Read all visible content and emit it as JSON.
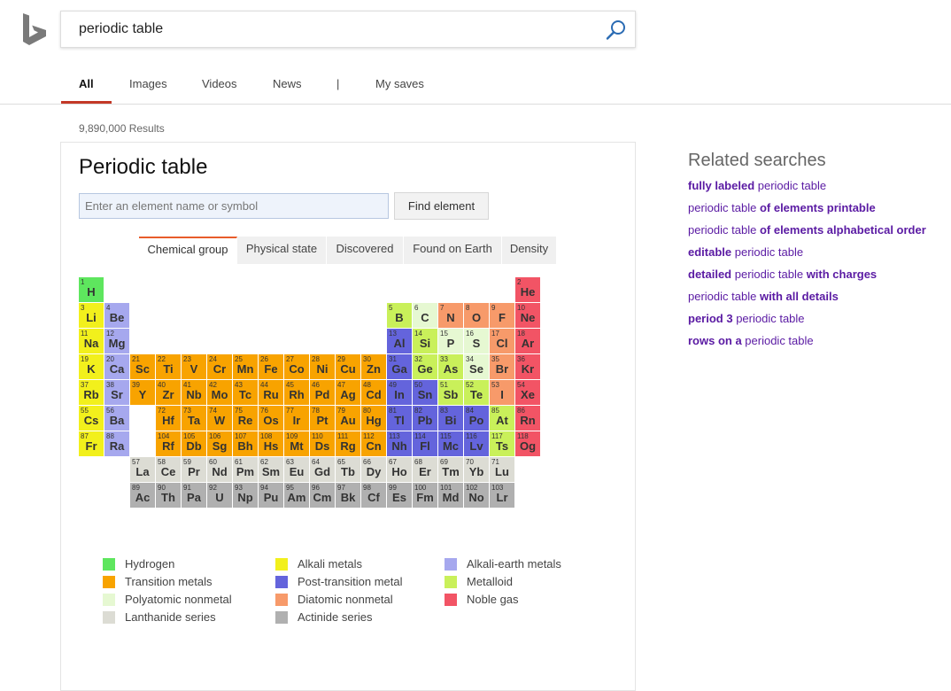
{
  "search": {
    "query": "periodic table"
  },
  "nav": {
    "tabs": [
      "All",
      "Images",
      "Videos",
      "News",
      "|",
      "My saves"
    ],
    "active": "All"
  },
  "results_count": "9,890,000 Results",
  "card": {
    "title": "Periodic table",
    "input_placeholder": "Enter an element name or symbol",
    "find_button": "Find element",
    "tabs": [
      "Chemical group",
      "Physical state",
      "Discovered",
      "Found on Earth",
      "Density"
    ],
    "active_tab": "Chemical group"
  },
  "colors": {
    "hydrogen": "#5ee65e",
    "alkali": "#f2f01c",
    "alkaline_earth": "#a6a8ee",
    "transition": "#f8a300",
    "post_transition": "#6464dc",
    "metalloid": "#c9f05a",
    "polyatomic": "#e6f8d2",
    "diatomic": "#f79a6a",
    "noble": "#f25465",
    "lanthanide": "#dcdcd4",
    "actinide": "#b0b0b0",
    "accent": "#c33827",
    "link": "#5a1aa3"
  },
  "elements": [
    {
      "n": "1",
      "s": "H",
      "p": 1,
      "g": 1,
      "c": "hydrogen"
    },
    {
      "n": "2",
      "s": "He",
      "p": 1,
      "g": 18,
      "c": "noble"
    },
    {
      "n": "3",
      "s": "Li",
      "p": 2,
      "g": 1,
      "c": "alkali"
    },
    {
      "n": "4",
      "s": "Be",
      "p": 2,
      "g": 2,
      "c": "alkaline_earth"
    },
    {
      "n": "5",
      "s": "B",
      "p": 2,
      "g": 13,
      "c": "metalloid"
    },
    {
      "n": "6",
      "s": "C",
      "p": 2,
      "g": 14,
      "c": "polyatomic"
    },
    {
      "n": "7",
      "s": "N",
      "p": 2,
      "g": 15,
      "c": "diatomic"
    },
    {
      "n": "8",
      "s": "O",
      "p": 2,
      "g": 16,
      "c": "diatomic"
    },
    {
      "n": "9",
      "s": "F",
      "p": 2,
      "g": 17,
      "c": "diatomic"
    },
    {
      "n": "10",
      "s": "Ne",
      "p": 2,
      "g": 18,
      "c": "noble"
    },
    {
      "n": "11",
      "s": "Na",
      "p": 3,
      "g": 1,
      "c": "alkali"
    },
    {
      "n": "12",
      "s": "Mg",
      "p": 3,
      "g": 2,
      "c": "alkaline_earth"
    },
    {
      "n": "13",
      "s": "Al",
      "p": 3,
      "g": 13,
      "c": "post_transition"
    },
    {
      "n": "14",
      "s": "Si",
      "p": 3,
      "g": 14,
      "c": "metalloid"
    },
    {
      "n": "15",
      "s": "P",
      "p": 3,
      "g": 15,
      "c": "polyatomic"
    },
    {
      "n": "16",
      "s": "S",
      "p": 3,
      "g": 16,
      "c": "polyatomic"
    },
    {
      "n": "17",
      "s": "Cl",
      "p": 3,
      "g": 17,
      "c": "diatomic"
    },
    {
      "n": "18",
      "s": "Ar",
      "p": 3,
      "g": 18,
      "c": "noble"
    },
    {
      "n": "19",
      "s": "K",
      "p": 4,
      "g": 1,
      "c": "alkali"
    },
    {
      "n": "20",
      "s": "Ca",
      "p": 4,
      "g": 2,
      "c": "alkaline_earth"
    },
    {
      "n": "21",
      "s": "Sc",
      "p": 4,
      "g": 3,
      "c": "transition"
    },
    {
      "n": "22",
      "s": "Ti",
      "p": 4,
      "g": 4,
      "c": "transition"
    },
    {
      "n": "23",
      "s": "V",
      "p": 4,
      "g": 5,
      "c": "transition"
    },
    {
      "n": "24",
      "s": "Cr",
      "p": 4,
      "g": 6,
      "c": "transition"
    },
    {
      "n": "25",
      "s": "Mn",
      "p": 4,
      "g": 7,
      "c": "transition"
    },
    {
      "n": "26",
      "s": "Fe",
      "p": 4,
      "g": 8,
      "c": "transition"
    },
    {
      "n": "27",
      "s": "Co",
      "p": 4,
      "g": 9,
      "c": "transition"
    },
    {
      "n": "28",
      "s": "Ni",
      "p": 4,
      "g": 10,
      "c": "transition"
    },
    {
      "n": "29",
      "s": "Cu",
      "p": 4,
      "g": 11,
      "c": "transition"
    },
    {
      "n": "30",
      "s": "Zn",
      "p": 4,
      "g": 12,
      "c": "transition"
    },
    {
      "n": "31",
      "s": "Ga",
      "p": 4,
      "g": 13,
      "c": "post_transition"
    },
    {
      "n": "32",
      "s": "Ge",
      "p": 4,
      "g": 14,
      "c": "metalloid"
    },
    {
      "n": "33",
      "s": "As",
      "p": 4,
      "g": 15,
      "c": "metalloid"
    },
    {
      "n": "34",
      "s": "Se",
      "p": 4,
      "g": 16,
      "c": "polyatomic"
    },
    {
      "n": "35",
      "s": "Br",
      "p": 4,
      "g": 17,
      "c": "diatomic"
    },
    {
      "n": "36",
      "s": "Kr",
      "p": 4,
      "g": 18,
      "c": "noble"
    },
    {
      "n": "37",
      "s": "Rb",
      "p": 5,
      "g": 1,
      "c": "alkali"
    },
    {
      "n": "38",
      "s": "Sr",
      "p": 5,
      "g": 2,
      "c": "alkaline_earth"
    },
    {
      "n": "39",
      "s": "Y",
      "p": 5,
      "g": 3,
      "c": "transition"
    },
    {
      "n": "40",
      "s": "Zr",
      "p": 5,
      "g": 4,
      "c": "transition"
    },
    {
      "n": "41",
      "s": "Nb",
      "p": 5,
      "g": 5,
      "c": "transition"
    },
    {
      "n": "42",
      "s": "Mo",
      "p": 5,
      "g": 6,
      "c": "transition"
    },
    {
      "n": "43",
      "s": "Tc",
      "p": 5,
      "g": 7,
      "c": "transition"
    },
    {
      "n": "44",
      "s": "Ru",
      "p": 5,
      "g": 8,
      "c": "transition"
    },
    {
      "n": "45",
      "s": "Rh",
      "p": 5,
      "g": 9,
      "c": "transition"
    },
    {
      "n": "46",
      "s": "Pd",
      "p": 5,
      "g": 10,
      "c": "transition"
    },
    {
      "n": "47",
      "s": "Ag",
      "p": 5,
      "g": 11,
      "c": "transition"
    },
    {
      "n": "48",
      "s": "Cd",
      "p": 5,
      "g": 12,
      "c": "transition"
    },
    {
      "n": "49",
      "s": "In",
      "p": 5,
      "g": 13,
      "c": "post_transition"
    },
    {
      "n": "50",
      "s": "Sn",
      "p": 5,
      "g": 14,
      "c": "post_transition"
    },
    {
      "n": "51",
      "s": "Sb",
      "p": 5,
      "g": 15,
      "c": "metalloid"
    },
    {
      "n": "52",
      "s": "Te",
      "p": 5,
      "g": 16,
      "c": "metalloid"
    },
    {
      "n": "53",
      "s": "I",
      "p": 5,
      "g": 17,
      "c": "diatomic"
    },
    {
      "n": "54",
      "s": "Xe",
      "p": 5,
      "g": 18,
      "c": "noble"
    },
    {
      "n": "55",
      "s": "Cs",
      "p": 6,
      "g": 1,
      "c": "alkali"
    },
    {
      "n": "56",
      "s": "Ba",
      "p": 6,
      "g": 2,
      "c": "alkaline_earth"
    },
    {
      "n": "72",
      "s": "Hf",
      "p": 6,
      "g": 4,
      "c": "transition"
    },
    {
      "n": "73",
      "s": "Ta",
      "p": 6,
      "g": 5,
      "c": "transition"
    },
    {
      "n": "74",
      "s": "W",
      "p": 6,
      "g": 6,
      "c": "transition"
    },
    {
      "n": "75",
      "s": "Re",
      "p": 6,
      "g": 7,
      "c": "transition"
    },
    {
      "n": "76",
      "s": "Os",
      "p": 6,
      "g": 8,
      "c": "transition"
    },
    {
      "n": "77",
      "s": "Ir",
      "p": 6,
      "g": 9,
      "c": "transition"
    },
    {
      "n": "78",
      "s": "Pt",
      "p": 6,
      "g": 10,
      "c": "transition"
    },
    {
      "n": "79",
      "s": "Au",
      "p": 6,
      "g": 11,
      "c": "transition"
    },
    {
      "n": "80",
      "s": "Hg",
      "p": 6,
      "g": 12,
      "c": "transition"
    },
    {
      "n": "81",
      "s": "Tl",
      "p": 6,
      "g": 13,
      "c": "post_transition"
    },
    {
      "n": "82",
      "s": "Pb",
      "p": 6,
      "g": 14,
      "c": "post_transition"
    },
    {
      "n": "83",
      "s": "Bi",
      "p": 6,
      "g": 15,
      "c": "post_transition"
    },
    {
      "n": "84",
      "s": "Po",
      "p": 6,
      "g": 16,
      "c": "post_transition"
    },
    {
      "n": "85",
      "s": "At",
      "p": 6,
      "g": 17,
      "c": "metalloid"
    },
    {
      "n": "86",
      "s": "Rn",
      "p": 6,
      "g": 18,
      "c": "noble"
    },
    {
      "n": "87",
      "s": "Fr",
      "p": 7,
      "g": 1,
      "c": "alkali"
    },
    {
      "n": "88",
      "s": "Ra",
      "p": 7,
      "g": 2,
      "c": "alkaline_earth"
    },
    {
      "n": "104",
      "s": "Rf",
      "p": 7,
      "g": 4,
      "c": "transition"
    },
    {
      "n": "105",
      "s": "Db",
      "p": 7,
      "g": 5,
      "c": "transition"
    },
    {
      "n": "106",
      "s": "Sg",
      "p": 7,
      "g": 6,
      "c": "transition"
    },
    {
      "n": "107",
      "s": "Bh",
      "p": 7,
      "g": 7,
      "c": "transition"
    },
    {
      "n": "108",
      "s": "Hs",
      "p": 7,
      "g": 8,
      "c": "transition"
    },
    {
      "n": "109",
      "s": "Mt",
      "p": 7,
      "g": 9,
      "c": "transition"
    },
    {
      "n": "110",
      "s": "Ds",
      "p": 7,
      "g": 10,
      "c": "transition"
    },
    {
      "n": "111",
      "s": "Rg",
      "p": 7,
      "g": 11,
      "c": "transition"
    },
    {
      "n": "112",
      "s": "Cn",
      "p": 7,
      "g": 12,
      "c": "transition"
    },
    {
      "n": "113",
      "s": "Nh",
      "p": 7,
      "g": 13,
      "c": "post_transition"
    },
    {
      "n": "114",
      "s": "Fl",
      "p": 7,
      "g": 14,
      "c": "post_transition"
    },
    {
      "n": "115",
      "s": "Mc",
      "p": 7,
      "g": 15,
      "c": "post_transition"
    },
    {
      "n": "116",
      "s": "Lv",
      "p": 7,
      "g": 16,
      "c": "post_transition"
    },
    {
      "n": "117",
      "s": "Ts",
      "p": 7,
      "g": 17,
      "c": "metalloid"
    },
    {
      "n": "118",
      "s": "Og",
      "p": 7,
      "g": 18,
      "c": "noble"
    },
    {
      "n": "57",
      "s": "La",
      "p": 8,
      "g": 3,
      "c": "lanthanide"
    },
    {
      "n": "58",
      "s": "Ce",
      "p": 8,
      "g": 4,
      "c": "lanthanide"
    },
    {
      "n": "59",
      "s": "Pr",
      "p": 8,
      "g": 5,
      "c": "lanthanide"
    },
    {
      "n": "60",
      "s": "Nd",
      "p": 8,
      "g": 6,
      "c": "lanthanide"
    },
    {
      "n": "61",
      "s": "Pm",
      "p": 8,
      "g": 7,
      "c": "lanthanide"
    },
    {
      "n": "62",
      "s": "Sm",
      "p": 8,
      "g": 8,
      "c": "lanthanide"
    },
    {
      "n": "63",
      "s": "Eu",
      "p": 8,
      "g": 9,
      "c": "lanthanide"
    },
    {
      "n": "64",
      "s": "Gd",
      "p": 8,
      "g": 10,
      "c": "lanthanide"
    },
    {
      "n": "65",
      "s": "Tb",
      "p": 8,
      "g": 11,
      "c": "lanthanide"
    },
    {
      "n": "66",
      "s": "Dy",
      "p": 8,
      "g": 12,
      "c": "lanthanide"
    },
    {
      "n": "67",
      "s": "Ho",
      "p": 8,
      "g": 13,
      "c": "lanthanide"
    },
    {
      "n": "68",
      "s": "Er",
      "p": 8,
      "g": 14,
      "c": "lanthanide"
    },
    {
      "n": "69",
      "s": "Tm",
      "p": 8,
      "g": 15,
      "c": "lanthanide"
    },
    {
      "n": "70",
      "s": "Yb",
      "p": 8,
      "g": 16,
      "c": "lanthanide"
    },
    {
      "n": "71",
      "s": "Lu",
      "p": 8,
      "g": 17,
      "c": "lanthanide"
    },
    {
      "n": "89",
      "s": "Ac",
      "p": 9,
      "g": 3,
      "c": "actinide"
    },
    {
      "n": "90",
      "s": "Th",
      "p": 9,
      "g": 4,
      "c": "actinide"
    },
    {
      "n": "91",
      "s": "Pa",
      "p": 9,
      "g": 5,
      "c": "actinide"
    },
    {
      "n": "92",
      "s": "U",
      "p": 9,
      "g": 6,
      "c": "actinide"
    },
    {
      "n": "93",
      "s": "Np",
      "p": 9,
      "g": 7,
      "c": "actinide"
    },
    {
      "n": "94",
      "s": "Pu",
      "p": 9,
      "g": 8,
      "c": "actinide"
    },
    {
      "n": "95",
      "s": "Am",
      "p": 9,
      "g": 9,
      "c": "actinide"
    },
    {
      "n": "96",
      "s": "Cm",
      "p": 9,
      "g": 10,
      "c": "actinide"
    },
    {
      "n": "97",
      "s": "Bk",
      "p": 9,
      "g": 11,
      "c": "actinide"
    },
    {
      "n": "98",
      "s": "Cf",
      "p": 9,
      "g": 12,
      "c": "actinide"
    },
    {
      "n": "99",
      "s": "Es",
      "p": 9,
      "g": 13,
      "c": "actinide"
    },
    {
      "n": "100",
      "s": "Fm",
      "p": 9,
      "g": 14,
      "c": "actinide"
    },
    {
      "n": "101",
      "s": "Md",
      "p": 9,
      "g": 15,
      "c": "actinide"
    },
    {
      "n": "102",
      "s": "No",
      "p": 9,
      "g": 16,
      "c": "actinide"
    },
    {
      "n": "103",
      "s": "Lr",
      "p": 9,
      "g": 17,
      "c": "actinide"
    }
  ],
  "legend": [
    {
      "label": "Hydrogen",
      "c": "hydrogen"
    },
    {
      "label": "Alkali metals",
      "c": "alkali"
    },
    {
      "label": "Alkali-earth metals",
      "c": "alkaline_earth"
    },
    {
      "label": "Transition metals",
      "c": "transition"
    },
    {
      "label": "Post-transition metal",
      "c": "post_transition"
    },
    {
      "label": "Metalloid",
      "c": "metalloid"
    },
    {
      "label": "Polyatomic nonmetal",
      "c": "polyatomic"
    },
    {
      "label": "Diatomic nonmetal",
      "c": "diatomic"
    },
    {
      "label": "Noble gas",
      "c": "noble"
    },
    {
      "label": "Lanthanide series",
      "c": "lanthanide"
    },
    {
      "label": "Actinide series",
      "c": "actinide"
    }
  ],
  "related": {
    "title": "Related searches",
    "items": [
      [
        {
          "t": "fully labeled",
          "b": true
        },
        {
          "t": " periodic table",
          "b": false
        }
      ],
      [
        {
          "t": "periodic table ",
          "b": false
        },
        {
          "t": "of elements printable",
          "b": true
        }
      ],
      [
        {
          "t": "periodic table ",
          "b": false
        },
        {
          "t": "of elements alphabetical order",
          "b": true
        }
      ],
      [
        {
          "t": "editable",
          "b": true
        },
        {
          "t": " periodic table",
          "b": false
        }
      ],
      [
        {
          "t": "detailed",
          "b": true
        },
        {
          "t": " periodic table ",
          "b": false
        },
        {
          "t": "with charges",
          "b": true
        }
      ],
      [
        {
          "t": "periodic table ",
          "b": false
        },
        {
          "t": "with all details",
          "b": true
        }
      ],
      [
        {
          "t": "period 3",
          "b": true
        },
        {
          "t": " periodic table",
          "b": false
        }
      ],
      [
        {
          "t": "rows on a",
          "b": true
        },
        {
          "t": " periodic table",
          "b": false
        }
      ]
    ]
  }
}
